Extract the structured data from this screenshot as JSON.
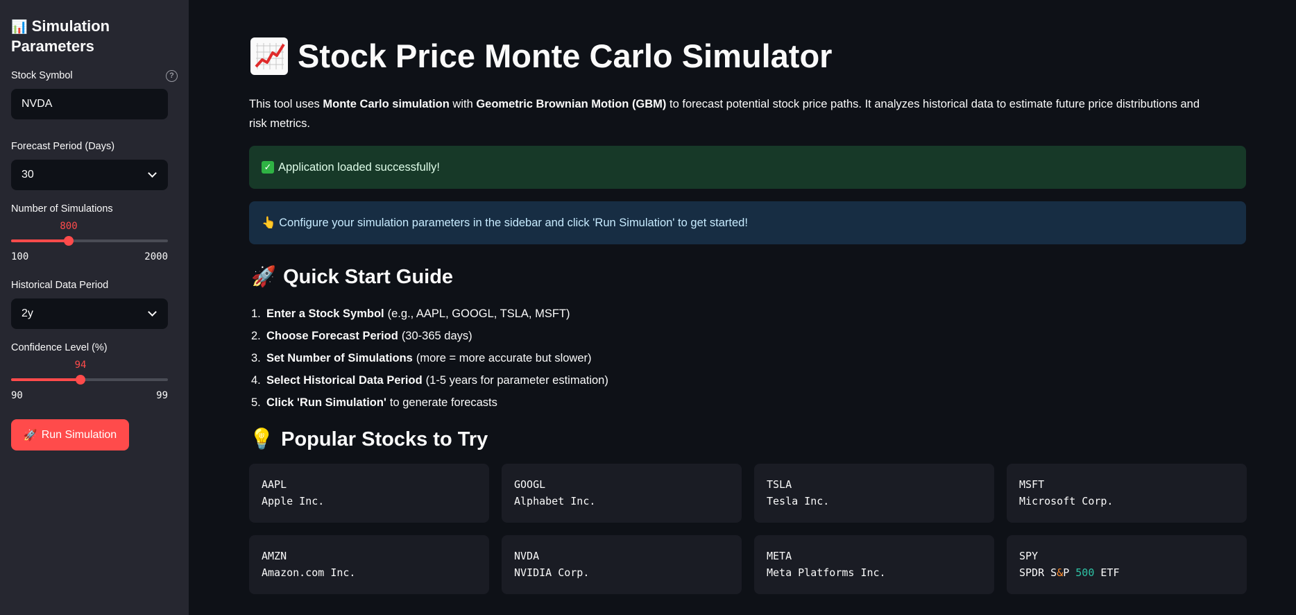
{
  "sidebar": {
    "title_emoji": "📊",
    "title": "Simulation Parameters",
    "stock_symbol": {
      "label": "Stock Symbol",
      "value": "NVDA",
      "help_icon": "question-circle-icon"
    },
    "forecast_period": {
      "label": "Forecast Period (Days)",
      "value": "30"
    },
    "num_simulations": {
      "label": "Number of Simulations",
      "value": "800",
      "min": "100",
      "max": "2000",
      "fraction": 0.368
    },
    "historical_period": {
      "label": "Historical Data Period",
      "value": "2y"
    },
    "confidence_level": {
      "label": "Confidence Level (%)",
      "value": "94",
      "min": "90",
      "max": "99",
      "fraction": 0.444
    },
    "run_button": {
      "emoji": "🚀",
      "label": "Run Simulation"
    }
  },
  "main": {
    "title": "Stock Price Monte Carlo Simulator",
    "title_icon": "chart-increasing-icon",
    "intro": {
      "p1": "This tool uses ",
      "b1": "Monte Carlo simulation",
      "p2": " with ",
      "b2": "Geometric Brownian Motion (GBM)",
      "p3": " to forecast potential stock price paths. It analyzes historical data to estimate future price distributions and risk metrics."
    },
    "success_alert": "Application loaded successfully!",
    "info_alert": "👆 Configure your simulation parameters in the sidebar and click 'Run Simulation' to get started!",
    "quick_start": {
      "emoji": "🚀",
      "title": "Quick Start Guide",
      "steps": [
        {
          "num": "1.",
          "bold": "Enter a Stock Symbol",
          "rest": "(e.g., AAPL, GOOGL, TSLA, MSFT)"
        },
        {
          "num": "2.",
          "bold": "Choose Forecast Period",
          "rest": "(30-365 days)"
        },
        {
          "num": "3.",
          "bold": "Set Number of Simulations",
          "rest": "(more = more accurate but slower)"
        },
        {
          "num": "4.",
          "bold": "Select Historical Data Period",
          "rest": "(1-5 years for parameter estimation)"
        },
        {
          "num": "5.",
          "bold": "Click 'Run Simulation'",
          "rest": "to generate forecasts"
        }
      ]
    },
    "popular": {
      "emoji": "💡",
      "title": "Popular Stocks to Try",
      "stocks": [
        {
          "ticker": "AAPL",
          "name": "Apple Inc."
        },
        {
          "ticker": "GOOGL",
          "name": "Alphabet Inc."
        },
        {
          "ticker": "TSLA",
          "name": "Tesla Inc."
        },
        {
          "ticker": "MSFT",
          "name": "Microsoft Corp."
        },
        {
          "ticker": "AMZN",
          "name": "Amazon.com Inc."
        },
        {
          "ticker": "NVDA",
          "name": "NVIDIA Corp."
        },
        {
          "ticker": "META",
          "name": "Meta Platforms Inc."
        },
        {
          "ticker": "SPY",
          "name_a": "SPDR S",
          "name_amp": "&",
          "name_b": "P ",
          "name_num": "500",
          "name_c": " ETF"
        }
      ]
    }
  },
  "colors": {
    "accent": "#ff4b4b",
    "sidebar_bg": "#262730",
    "main_bg": "#0e1117",
    "success_bg": "#173928",
    "info_bg": "#172d43"
  }
}
